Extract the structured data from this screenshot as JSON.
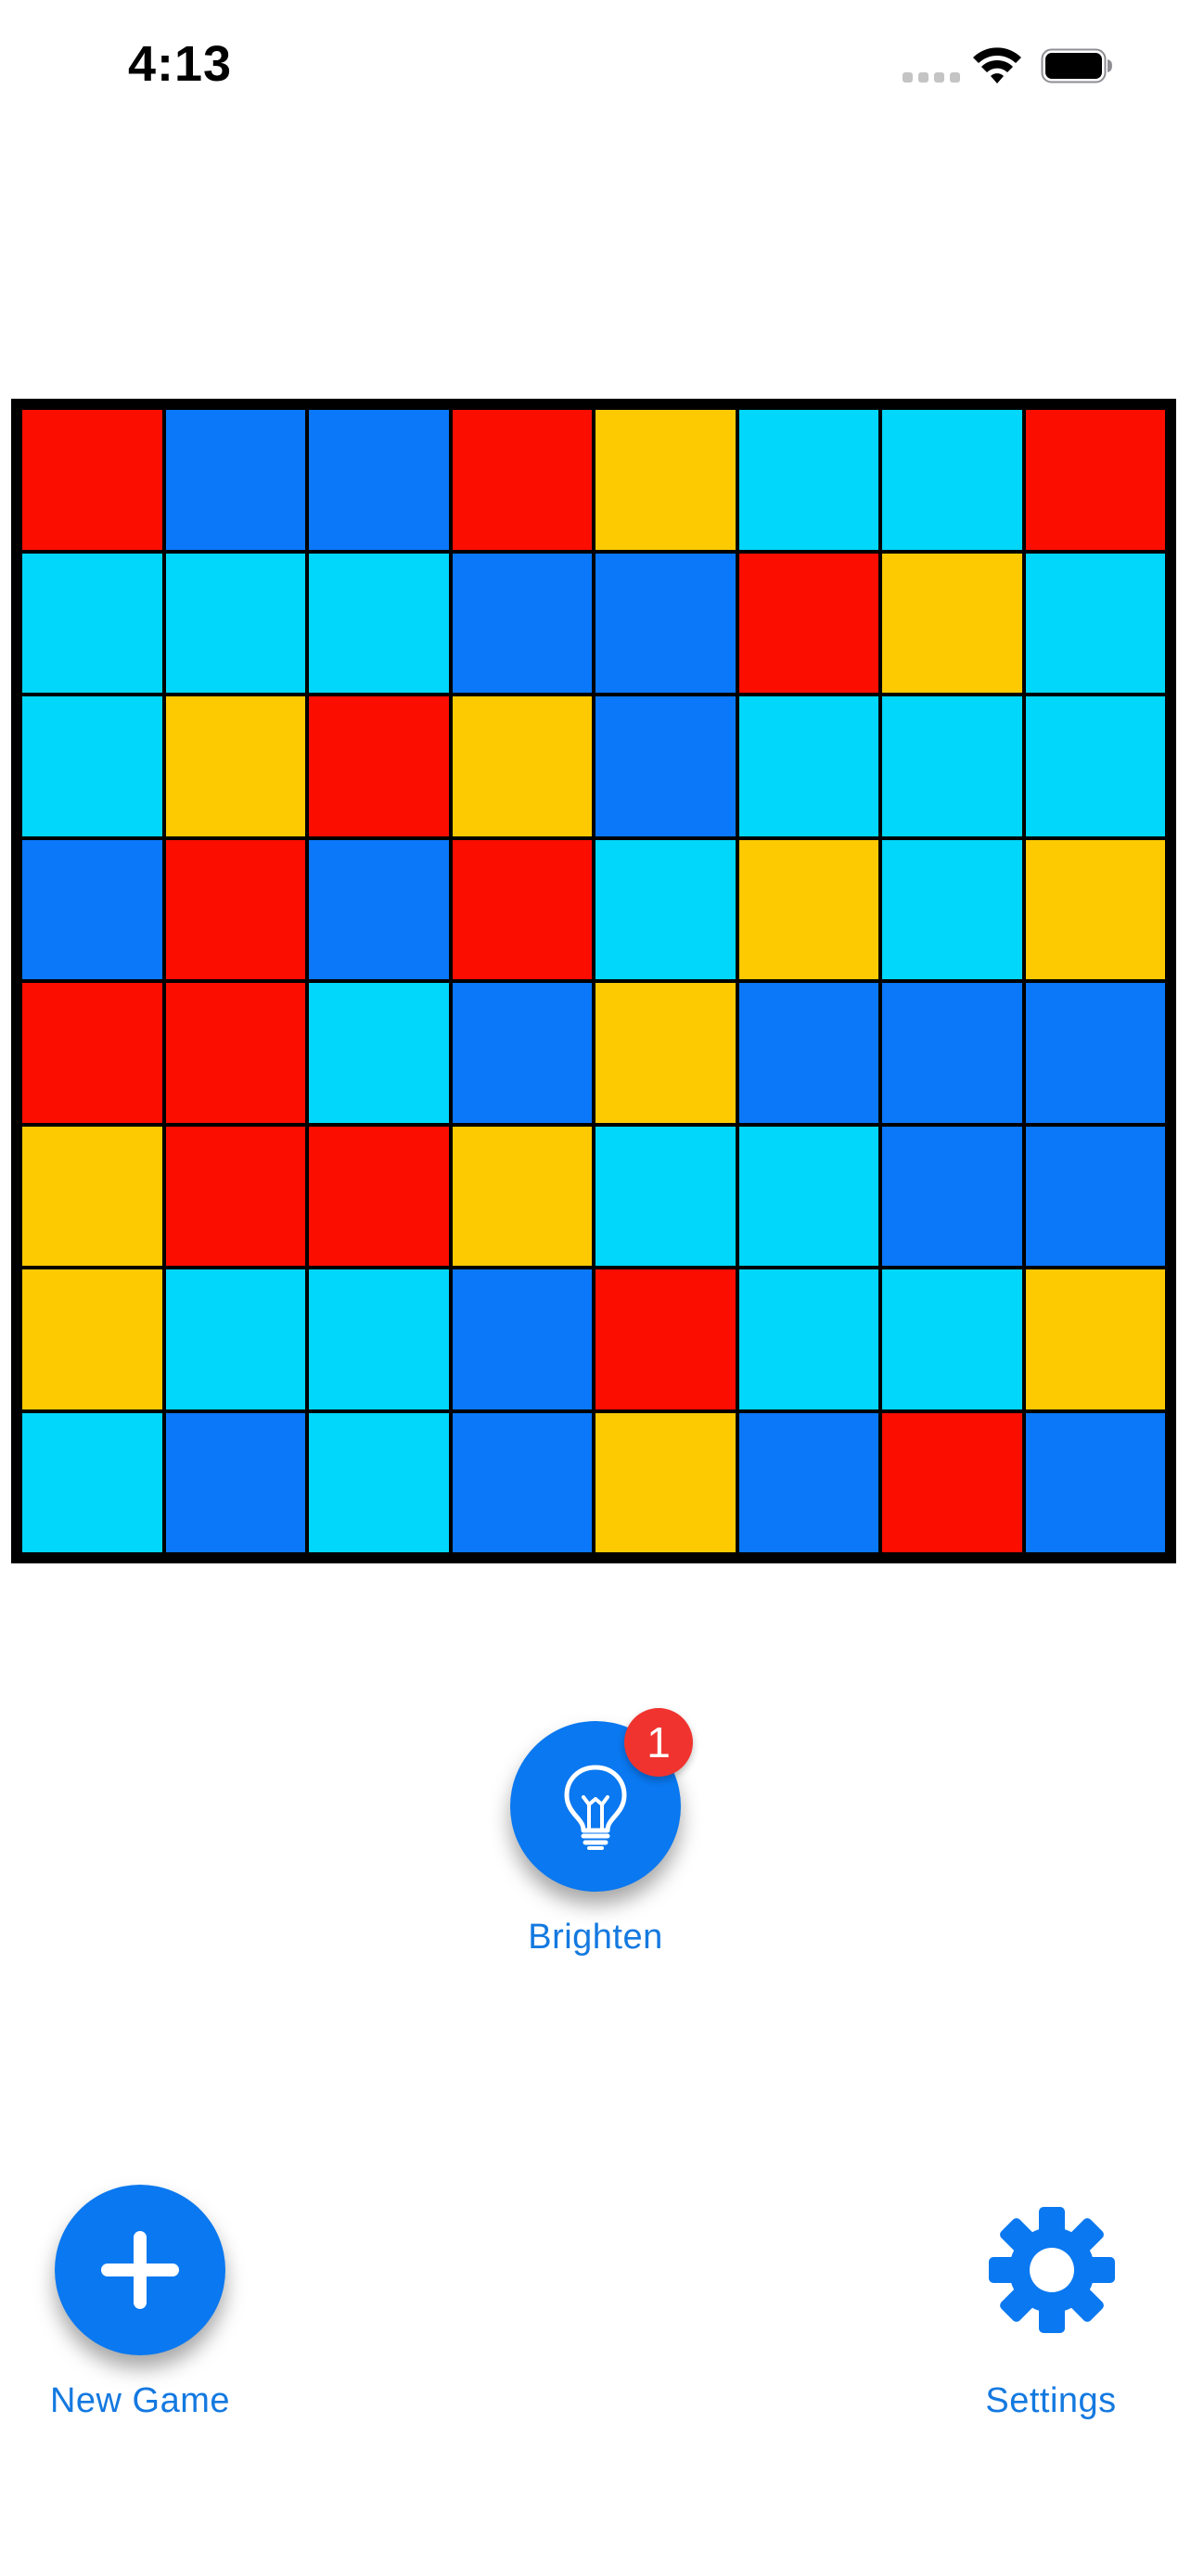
{
  "status_bar": {
    "time": "4:13",
    "icons": [
      "cellular-signal-icon",
      "wifi-icon",
      "battery-icon"
    ]
  },
  "board": {
    "rows": 8,
    "cols": 8,
    "palette": {
      "R": "#fb0d00",
      "B": "#0a78f9",
      "C": "#00d7fb",
      "Y": "#fdc901"
    },
    "grid": [
      [
        "R",
        "B",
        "B",
        "R",
        "Y",
        "C",
        "C",
        "R"
      ],
      [
        "C",
        "C",
        "C",
        "B",
        "B",
        "R",
        "Y",
        "C"
      ],
      [
        "C",
        "Y",
        "R",
        "Y",
        "B",
        "C",
        "C",
        "C"
      ],
      [
        "B",
        "R",
        "B",
        "R",
        "C",
        "Y",
        "C",
        "Y"
      ],
      [
        "R",
        "R",
        "C",
        "B",
        "Y",
        "B",
        "B",
        "B"
      ],
      [
        "Y",
        "R",
        "R",
        "Y",
        "C",
        "C",
        "B",
        "B"
      ],
      [
        "Y",
        "C",
        "C",
        "B",
        "R",
        "C",
        "C",
        "Y"
      ],
      [
        "C",
        "B",
        "C",
        "B",
        "Y",
        "B",
        "R",
        "B"
      ]
    ]
  },
  "brighten": {
    "label": "Brighten",
    "badge_count": "1",
    "icon": "lightbulb-icon"
  },
  "new_game": {
    "label": "New Game",
    "icon": "plus-icon"
  },
  "settings": {
    "label": "Settings",
    "icon": "gear-icon"
  },
  "colors": {
    "accent": "#0a78f0",
    "badge": "#f0332f",
    "label_text": "#1479e0"
  }
}
